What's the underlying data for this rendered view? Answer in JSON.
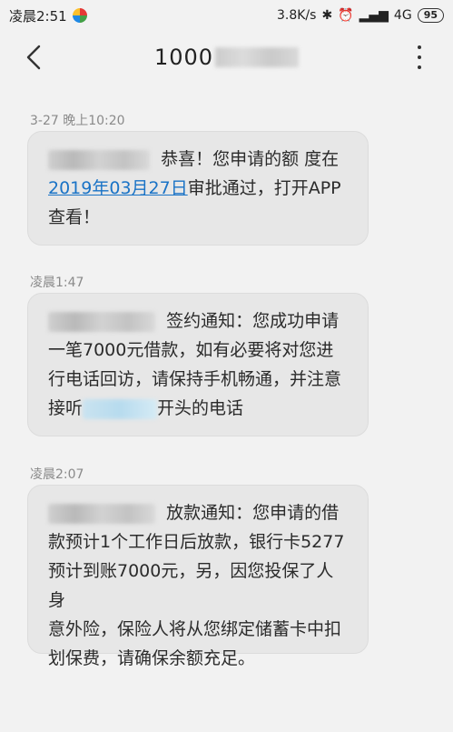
{
  "status_bar": {
    "time": "凌晨2:51",
    "net_speed": "3.8K/s",
    "signal": "4G",
    "battery": "95"
  },
  "header": {
    "title": "1000"
  },
  "messages": [
    {
      "time": "3-27 晚上10:20",
      "text_a": "恭喜！您申请的额 度在",
      "link": "2019年03月27日",
      "text_b": "审批通过，打开APP",
      "text_c": "查看！"
    },
    {
      "time": "凌晨1:47",
      "text_a": "签约通知：您成功申请",
      "text_b": "一笔7000元借款，如有必要将对您进",
      "text_c": "行电话回访，请保持手机畅通，并注意",
      "text_d": "接听",
      "text_e": "开头的电话"
    },
    {
      "time": "凌晨2:07",
      "text_a": "放款通知：您申请的借",
      "text_b": "款预计1个工作日后放款，银行卡5277",
      "text_c": "预计到账7000元，另，因您投保了人身",
      "text_d": "意外险，保险人将从您绑定储蓄卡中扣",
      "text_e": "划保费，请确保余额充足。"
    }
  ]
}
